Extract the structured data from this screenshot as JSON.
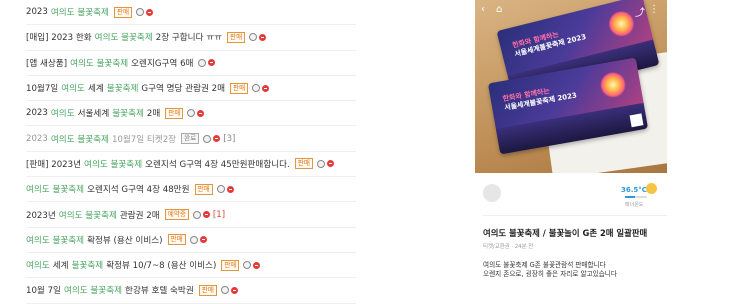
{
  "posts": [
    {
      "segments": [
        {
          "t": "2023 ",
          "c": "n"
        },
        {
          "t": "여의도 불꽃축제",
          "c": "g"
        }
      ],
      "tag": "판매",
      "icons": [
        "smile",
        "red"
      ]
    },
    {
      "segments": [
        {
          "t": "[매입] 2023 한화 ",
          "c": "n"
        },
        {
          "t": "여의도 불꽃축제",
          "c": "g"
        },
        {
          "t": " 2장 구합니다 ㅠㅠ",
          "c": "n"
        }
      ],
      "tag": "판매",
      "icons": [
        "smile",
        "red"
      ]
    },
    {
      "segments": [
        {
          "t": "[앱 새상품]",
          "c": "n"
        },
        {
          "t": "여의도 불꽃축제",
          "c": "g"
        },
        {
          "t": " 오렌지G구역 6매",
          "c": "n"
        }
      ],
      "icons": [
        "smile",
        "red"
      ]
    },
    {
      "segments": [
        {
          "t": "10월7일 ",
          "c": "n"
        },
        {
          "t": "여의도",
          "c": "g"
        },
        {
          "t": " 세계",
          "c": "n"
        },
        {
          "t": "불꽃축제",
          "c": "g"
        },
        {
          "t": " G구역 명당 관람권 2매",
          "c": "n"
        }
      ],
      "tag": "판매",
      "icons": [
        "smile",
        "red"
      ]
    },
    {
      "segments": [
        {
          "t": "2023 ",
          "c": "n"
        },
        {
          "t": "여의도",
          "c": "g"
        },
        {
          "t": " 서울세계",
          "c": "n"
        },
        {
          "t": "불꽃축제",
          "c": "g"
        },
        {
          "t": " 2매",
          "c": "n"
        }
      ],
      "tag": "판매",
      "icons": [
        "smile",
        "red"
      ]
    },
    {
      "segments": [
        {
          "t": "2023",
          "c": "m"
        },
        {
          "t": "여의도 불꽃축제",
          "c": "g"
        },
        {
          "t": " 10월7일 티켓2장",
          "c": "m"
        }
      ],
      "tag": "완료",
      "tag_done": true,
      "icons": [
        "smile",
        "red"
      ],
      "count": "[3]",
      "count_gray": true
    },
    {
      "segments": [
        {
          "t": "[판매] 2023년 ",
          "c": "n"
        },
        {
          "t": "여의도 불꽃축제",
          "c": "g"
        },
        {
          "t": " 오렌지석 G구역 4장 45만원판매합니다.",
          "c": "n"
        }
      ],
      "tag": "판매",
      "icons": [
        "smile",
        "red"
      ]
    },
    {
      "segments": [
        {
          "t": "여의도 불꽃축제",
          "c": "g"
        },
        {
          "t": " 오렌지석 G구역 4장 48만원",
          "c": "n"
        }
      ],
      "tag": "판매",
      "icons": [
        "smile",
        "red"
      ]
    },
    {
      "segments": [
        {
          "t": "2023년 ",
          "c": "n"
        },
        {
          "t": "여의도 불꽃축제",
          "c": "g"
        },
        {
          "t": " 관람권 2매",
          "c": "n"
        }
      ],
      "tag": "예약중",
      "icons": [
        "smile",
        "red"
      ],
      "count": "[1]"
    },
    {
      "segments": [
        {
          "t": "여의도 불꽃축제",
          "c": "g"
        },
        {
          "t": " 확정뷰 (용산 이비스)",
          "c": "n"
        }
      ],
      "tag": "판매",
      "icons": [
        "smile",
        "red"
      ]
    },
    {
      "segments": [
        {
          "t": "여의도",
          "c": "g"
        },
        {
          "t": " 세계 ",
          "c": "n"
        },
        {
          "t": "불꽃축제",
          "c": "g"
        },
        {
          "t": " 확정뷰 10/7~8 (용산 이비스)",
          "c": "n"
        }
      ],
      "tag": "판매",
      "icons": [
        "smile",
        "red"
      ]
    },
    {
      "segments": [
        {
          "t": "10월 7일 ",
          "c": "n"
        },
        {
          "t": "여의도 불꽃축제",
          "c": "g"
        },
        {
          "t": " 한강뷰 호텔 숙박권",
          "c": "n"
        }
      ],
      "tag": "판매",
      "icons": [
        "smile",
        "red"
      ]
    }
  ],
  "product": {
    "photo_icons": {
      "back": "chevron-left-icon",
      "home": "home-icon",
      "share": "share-icon",
      "more": "more-icon"
    },
    "ticket_lines": [
      "한화와 함께하는",
      "서울세계불꽃축제 2023"
    ],
    "seller_temp": "36.5°C",
    "temp_level": 0.45,
    "manner_label": "매너온도",
    "title": "여의도 불꽃축제 / 불꽃놀이 G존 2매 일괄판매",
    "meta": "티켓/교환권 · 24분 전",
    "body_lines": [
      "여의도 불꽃축제 G존 불꽃관람석 판매합니다",
      "오렌지 존으로, 굉장히 좋은 자리로 알고있습니다"
    ]
  },
  "colors": {
    "keyword": "#4aa562",
    "tag": "#e37b1a",
    "temperature": "#2f9bd6"
  }
}
